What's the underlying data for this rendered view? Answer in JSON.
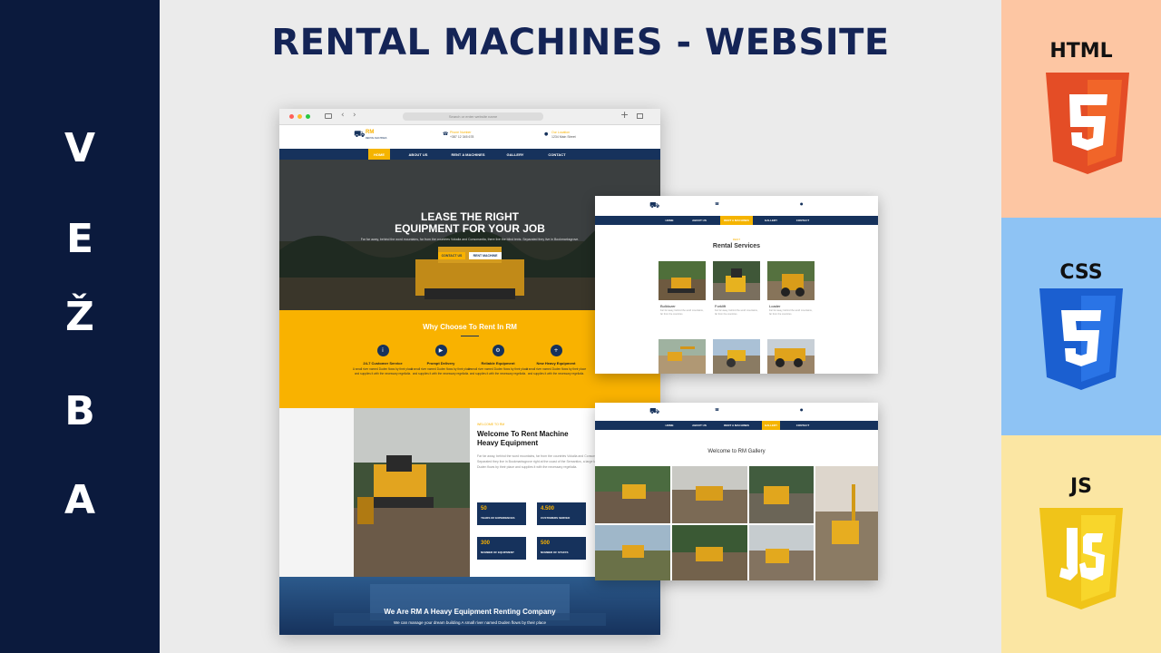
{
  "left_letters": [
    "V",
    "E",
    "Ž",
    "B",
    "A"
  ],
  "main_title": "RENTAL MACHINES - WEBSITE",
  "tech": [
    {
      "label": "HTML",
      "glyph": "5",
      "bg": "#fdc6a3",
      "shield": "#e44d26",
      "shield_light": "#f16529"
    },
    {
      "label": "CSS",
      "glyph": "3",
      "bg": "#8ec3f4",
      "shield": "#1b5fd0",
      "shield_light": "#2a74e6"
    },
    {
      "label": "JS",
      "glyph": "JS",
      "bg": "#fbe6a3",
      "shield": "#f0c419",
      "shield_light": "#f8d62b"
    }
  ],
  "colors": {
    "navy": "#16325c",
    "yellow": "#f9b200",
    "dark": "#0b1a3d"
  },
  "browser": {
    "url_placeholder": "Search or enter website name",
    "logo": {
      "mark": "RM",
      "sub": "RENTAL MACHINES"
    },
    "contact": [
      {
        "label": "Phone Number",
        "value": "+387 12 345 678"
      },
      {
        "label": "Our Location",
        "value": "1234 Main Street"
      }
    ],
    "nav": [
      "HOME",
      "ABOUT US",
      "RENT A MACHINES",
      "GALLERY",
      "CONTACT"
    ],
    "hero": {
      "title_line1": "LEASE THE RIGHT",
      "title_line2": "EQUIPMENT FOR YOUR JOB",
      "text": "Far far away, behind the word mountains, far from the countries Vokalia and Consonantia, there live the blind texts. Separated they live in Bookmarksgrove.",
      "btn_primary": "CONTACT US",
      "btn_secondary": "RENT MACHINE"
    },
    "why": {
      "title": "Why Choose To Rent In RM",
      "features": [
        {
          "icon": "i",
          "title": "24-7 Customer Service",
          "text": "A small river named Duden flows by their place and supplies it with the necessary regelialia."
        },
        {
          "icon": "▶",
          "title": "Prompt Delivery",
          "text": "A small river named Duden flows by their place and supplies it with the necessary regelialia."
        },
        {
          "icon": "⚙",
          "title": "Reliable Equipment",
          "text": "A small river named Duden flows by their place and supplies it with the necessary regelialia."
        },
        {
          "icon": "+",
          "title": "New Heavy Equipment",
          "text": "A small river named Duden flows by their place and supplies it with the necessary regelialia."
        }
      ]
    },
    "about": {
      "kicker": "WELCOME TO RM",
      "title_line1": "Welcome To Rent Machine",
      "title_line2": "Heavy Equipment",
      "text": "Far far away, behind the word mountains, far from the countries Vokalia and Consonantia, there live the blind texts. Separated they live in Bookmarksgrove right at the coast of the Semantics, a large language ocean. A small river named Duden flows by their place and supplies it with the necessary regelialia.",
      "stats": [
        {
          "num": "50",
          "label": "YEARS OF EXPERIENCES"
        },
        {
          "num": "4.500",
          "label": "CUSTOMERS SERVED"
        },
        {
          "num": "300",
          "label": "NUMBER OF EQUIPMENT"
        },
        {
          "num": "500",
          "label": "NUMBER OF STAFFS"
        }
      ]
    },
    "company": {
      "title": "We Are RM A Heavy Equipment Renting Company",
      "text": "We can manage your dream building A small river named Duden flows by their place"
    }
  },
  "rental_card": {
    "nav": [
      "HOME",
      "ABOUT US",
      "RENT A MACHINES",
      "GALLERY",
      "CONTACT"
    ],
    "kicker": "RENT",
    "title": "Rental Services",
    "items": [
      {
        "name": "Bulldozer",
        "text": "Far far away, behind the word mountains, far from the countries"
      },
      {
        "name": "Forklift",
        "text": "Far far away, behind the word mountains, far from the countries"
      },
      {
        "name": "Loader",
        "text": "Far far away, behind the word mountains, far from the countries"
      }
    ]
  },
  "gallery_card": {
    "nav": [
      "HOME",
      "ABOUT US",
      "RENT A MACHINES",
      "GALLERY",
      "CONTACT"
    ],
    "title": "Welcome to RM Gallery"
  }
}
